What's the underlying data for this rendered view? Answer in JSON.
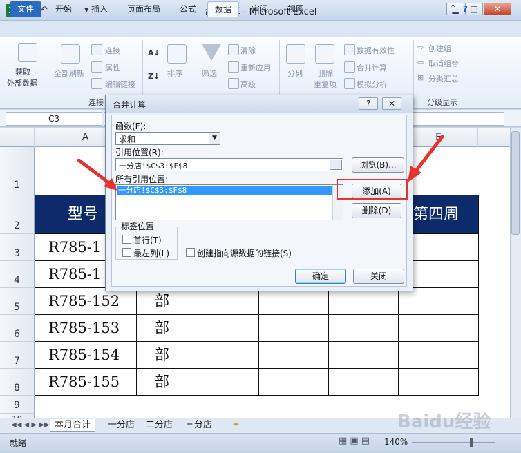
{
  "window": {
    "title": "合并计算 - Microsoft Excel",
    "app_icon": "X"
  },
  "ribbon_tabs": [
    {
      "label": "文件"
    },
    {
      "label": "开始"
    },
    {
      "label": "插入"
    },
    {
      "label": "页面布局"
    },
    {
      "label": "公式"
    },
    {
      "label": "数据"
    },
    {
      "label": "审阅"
    },
    {
      "label": "视图"
    }
  ],
  "ribbon": {
    "get_external": "获取\n外部数据",
    "get_external_1": "获取",
    "get_external_2": "外部数据",
    "refresh_all": "全部刷新",
    "connections": "连接",
    "properties": "属性",
    "edit_links": "编辑链接",
    "group_connections": "连接",
    "sort": "排序",
    "filter": "筛选",
    "clear": "清除",
    "reapply": "重新应用",
    "advanced": "高级",
    "split": "分列",
    "remove_dup_1": "删除",
    "remove_dup_2": "重复项",
    "data_validation": "数据有效性",
    "consolidate": "合并计算",
    "what_if": "模拟分析",
    "group": "创建组",
    "ungroup": "取消组合",
    "subtotal": "分类汇总",
    "group_outline": "分级显示"
  },
  "formula_bar": {
    "name_box": "C3",
    "formula": ""
  },
  "columns": [
    "A",
    "E"
  ],
  "rows": [
    "1",
    "2",
    "3",
    "4",
    "5",
    "6",
    "7",
    "8",
    "9",
    "10"
  ],
  "cells": {
    "header_a": "型号",
    "header_e": "第四周",
    "a3": "R785-1",
    "a4": "R785-1",
    "a5": "R785-152",
    "a6": "R785-153",
    "a7": "R785-154",
    "a8": "R785-155",
    "b5": "部",
    "b6": "部",
    "b7": "部",
    "b8": "部"
  },
  "sheets": [
    "本月合计",
    "一分店",
    "二分店",
    "三分店"
  ],
  "status": {
    "ready": "就绪",
    "zoom": "140%"
  },
  "dialog": {
    "title": "合并计算",
    "help": "?",
    "close": "✕",
    "function_label": "函数(F):",
    "function_value": "求和",
    "ref_label": "引用位置(R):",
    "ref_value": "一分店!$C$3:$F$8",
    "browse": "浏览(B)...",
    "all_refs_label": "所有引用位置:",
    "all_refs": [
      "一分店!$C$3:$F$8"
    ],
    "add": "添加(A)",
    "delete": "删除(D)",
    "label_pos": "标签位置",
    "top_row": "首行(T)",
    "left_col": "最左列(L)",
    "create_links": "创建指向源数据的链接(S)",
    "ok": "确定",
    "close_btn": "关闭"
  },
  "watermark": "Baidu经验",
  "colors": {
    "header_fill": "#0d2a6b",
    "accent": "#e8322e"
  }
}
